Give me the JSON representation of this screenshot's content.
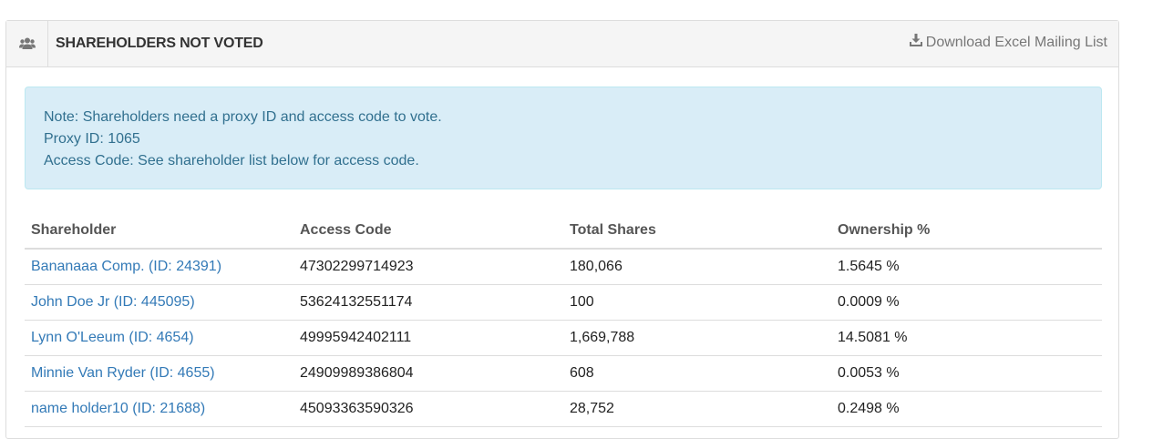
{
  "panel": {
    "title": "SHAREHOLDERS NOT VOTED",
    "header_icon": "users-icon",
    "download": {
      "icon": "download-icon",
      "label": "Download Excel Mailing List"
    }
  },
  "note": {
    "line1": "Note: Shareholders need a proxy ID and access code to vote.",
    "line2": "Proxy ID: 1065",
    "line3": "Access Code: See shareholder list below for access code."
  },
  "table": {
    "columns": [
      "Shareholder",
      "Access Code",
      "Total Shares",
      "Ownership %"
    ],
    "rows": [
      {
        "shareholder": "Bananaaa Comp. (ID: 24391)",
        "access_code": "47302299714923",
        "total_shares": "180,066",
        "ownership": "1.5645 %"
      },
      {
        "shareholder": "John Doe Jr (ID: 445095)",
        "access_code": "53624132551174",
        "total_shares": "100",
        "ownership": "0.0009 %"
      },
      {
        "shareholder": "Lynn O'Leeum (ID: 4654)",
        "access_code": "49995942402111",
        "total_shares": "1,669,788",
        "ownership": "14.5081 %"
      },
      {
        "shareholder": "Minnie Van Ryder (ID: 4655)",
        "access_code": "24909989386804",
        "total_shares": "608",
        "ownership": "0.0053 %"
      },
      {
        "shareholder": "name holder10 (ID: 21688)",
        "access_code": "45093363590326",
        "total_shares": "28,752",
        "ownership": "0.2498 %"
      }
    ]
  },
  "colors": {
    "link": "#337ab7",
    "alert_bg": "#d9edf7",
    "alert_text": "#31708f",
    "heading_bg": "#f5f5f5"
  }
}
